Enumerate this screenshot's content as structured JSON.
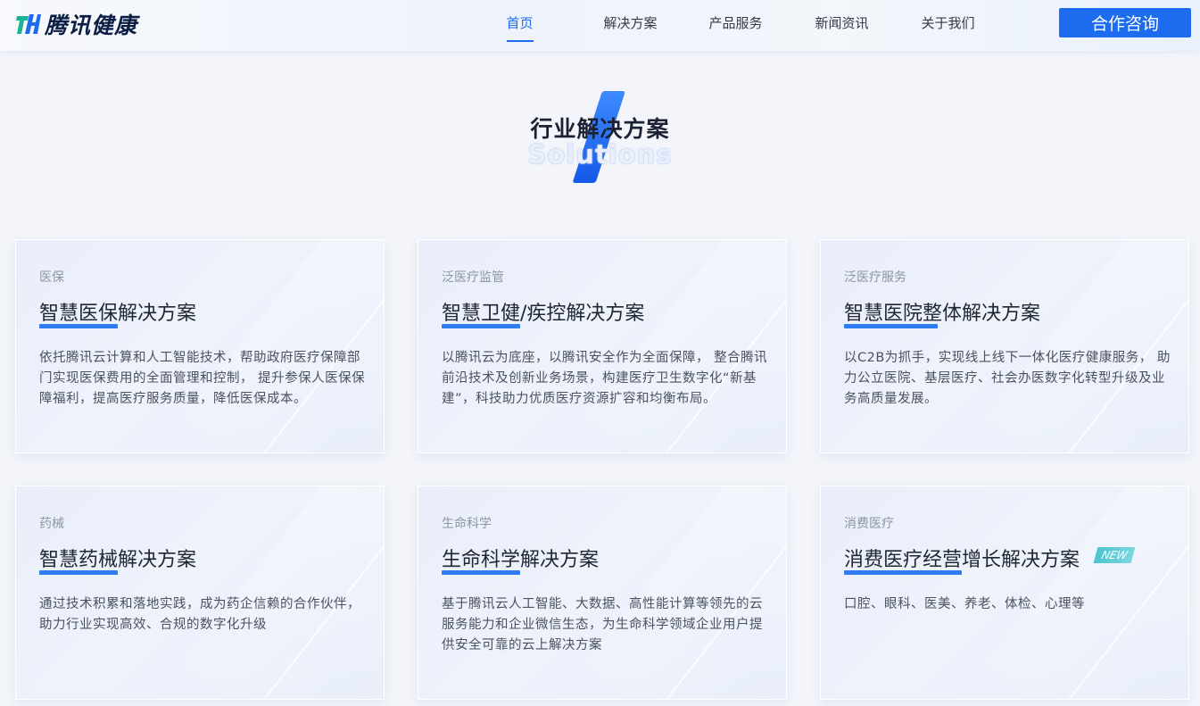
{
  "header": {
    "logo_text": "腾讯健康",
    "nav": [
      {
        "label": "首页",
        "active": true
      },
      {
        "label": "解决方案",
        "active": false
      },
      {
        "label": "产品服务",
        "active": false
      },
      {
        "label": "新闻资讯",
        "active": false
      },
      {
        "label": "关于我们",
        "active": false
      }
    ],
    "cta_label": "合作咨询"
  },
  "section": {
    "title_cn": "行业解决方案",
    "title_en": "Solutions"
  },
  "cards": [
    {
      "category": "医保",
      "title": "智慧医保解决方案",
      "desc": "依托腾讯云计算和人工智能技术，帮助政府医疗保障部门实现医保费用的全面管理和控制， 提升参保人医保保障福利，提高医疗服务质量，降低医保成本。"
    },
    {
      "category": "泛医疗监管",
      "title": "智慧卫健/疾控解决方案",
      "desc": "以腾讯云为底座，以腾讯安全作为全面保障， 整合腾讯前沿技术及创新业务场景，构建医疗卫生数字化“新基建”，科技助力优质医疗资源扩容和均衡布局。"
    },
    {
      "category": "泛医疗服务",
      "title": "智慧医院整体解决方案",
      "desc": "以C2B为抓手，实现线上线下一体化医疗健康服务， 助力公立医院、基层医疗、社会办医数字化转型升级及业务高质量发展。"
    },
    {
      "category": "药械",
      "title": "智慧药械解决方案",
      "desc": "通过技术积累和落地实践，成为药企信赖的合作伙伴，助力行业实现高效、合规的数字化升级"
    },
    {
      "category": "生命科学",
      "title": "生命科学解决方案",
      "desc": "基于腾讯云人工智能、大数据、高性能计算等领先的云服务能力和企业微信生态，为生命科学领域企业用户提供安全可靠的云上解决方案"
    },
    {
      "category": "消费医疗",
      "title": "消费医疗经营增长解决方案",
      "badge": "NEW",
      "desc": "口腔、眼科、医美、养老、体检、心理等"
    }
  ],
  "colors": {
    "accent": "#1d6cf0",
    "underline": "#2f7bf2",
    "badge": "#4cc3d1"
  }
}
